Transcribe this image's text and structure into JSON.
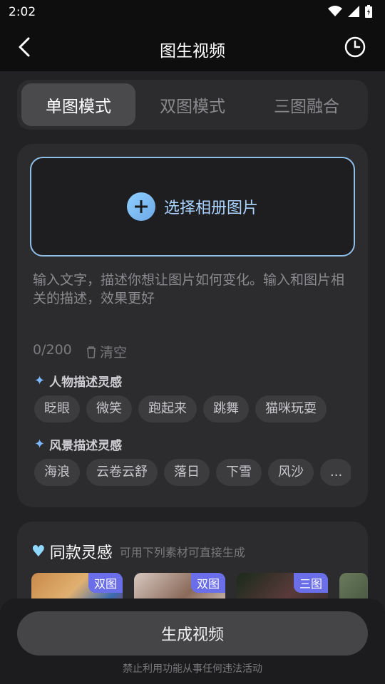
{
  "status_bar": {
    "time": "2:02"
  },
  "app_bar": {
    "title": "图生视频"
  },
  "tabs": [
    {
      "label": "单图模式",
      "active": true
    },
    {
      "label": "双图模式",
      "active": false
    },
    {
      "label": "三图融合",
      "active": false
    }
  ],
  "upload": {
    "label": "选择相册图片"
  },
  "prompt": {
    "placeholder": "输入文字，描述你想让图片如何变化。输入和图片相关的描述，效果更好",
    "counter": "0/200",
    "clear_label": "清空"
  },
  "inspiration_people": {
    "title": "人物描述灵感",
    "chips": [
      "眨眼",
      "微笑",
      "跑起来",
      "跳舞",
      "猫咪玩耍"
    ]
  },
  "inspiration_scenery": {
    "title": "风景描述灵感",
    "chips": [
      "海浪",
      "云卷云舒",
      "落日",
      "下雪",
      "风沙",
      "..."
    ]
  },
  "same_inspiration": {
    "title": "同款灵感",
    "subtitle": "可用下列素材可直接生成",
    "items": [
      {
        "badge": "双图"
      },
      {
        "badge": "双图"
      },
      {
        "badge": "三图"
      }
    ]
  },
  "bottom": {
    "generate_label": "生成视频",
    "notice": "禁止利用功能从事任何违法活动"
  },
  "colors": {
    "accent": "#8fbfe8",
    "badge": "#6a6ee8"
  }
}
